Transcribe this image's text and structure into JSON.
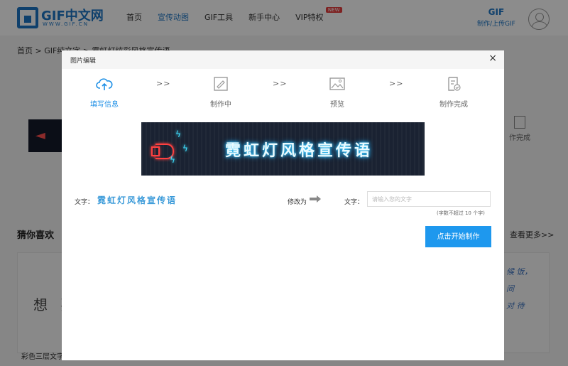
{
  "header": {
    "logo_text": "GIF中文网",
    "logo_sub": "WWW.GIF.CN",
    "nav": [
      {
        "label": "首页",
        "active": false
      },
      {
        "label": "宣传动图",
        "active": true
      },
      {
        "label": "GIF工具",
        "active": false
      },
      {
        "label": "新手中心",
        "active": false
      },
      {
        "label": "VIP特权",
        "active": false,
        "badge": "NEW"
      }
    ],
    "gif_badge": "GIF",
    "gif_make_label": "制作/上传GIF"
  },
  "page": {
    "breadcrumb": "首页 > GIF纯文字 > 霓虹灯炫彩风格宣传语",
    "step_done_label": "作完成",
    "guess_title": "猜你喜欢",
    "more_link": "查看更多>>",
    "card_left_text": "想 要",
    "card_left_caption": "彩色三层文字",
    "card_right_lines": [
      "候 饭，",
      "间",
      "对 待"
    ]
  },
  "modal": {
    "title": "图片编辑",
    "close_glyph": "×",
    "arrow_glyph": ">>",
    "steps": [
      {
        "label": "填写信息",
        "icon": "cloud-upload-icon",
        "active": true
      },
      {
        "label": "制作中",
        "icon": "edit-icon",
        "active": false
      },
      {
        "label": "预览",
        "icon": "image-icon",
        "active": false
      },
      {
        "label": "制作完成",
        "icon": "check-document-icon",
        "active": false
      }
    ],
    "banner_text": "霓虹灯风格宣传语",
    "text_label": "文字：",
    "current_text": "霓虹灯风格宣传语",
    "change_to_label": "修改为",
    "input_label": "文字：",
    "input_placeholder": "请输入您的文字",
    "input_value": "",
    "hint": "(字数不超过 10 个字)",
    "start_button": "点击开始制作"
  },
  "colors": {
    "brand": "#1d76c5",
    "accent": "#1e98ee",
    "neon_blue": "#3fd0ff",
    "neon_red": "#ff4040",
    "badge_red": "#e53e3e"
  }
}
